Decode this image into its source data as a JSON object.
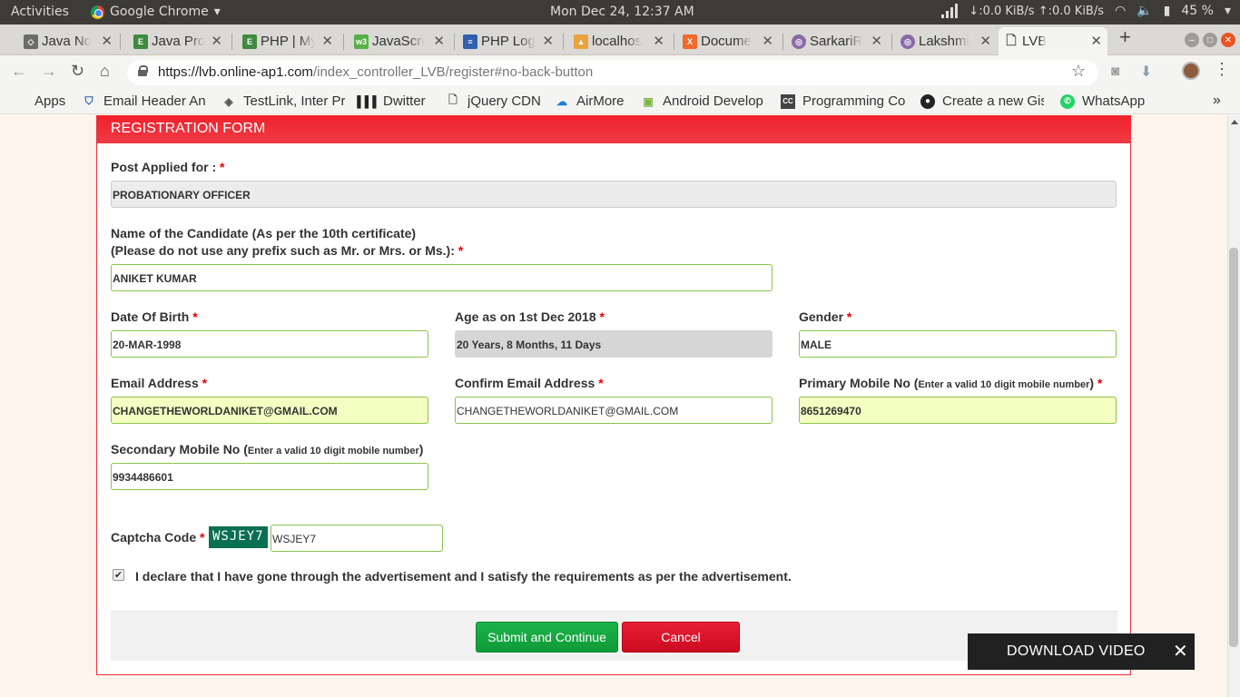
{
  "system_bar": {
    "activities": "Activities",
    "app_name": "Google Chrome",
    "clock": "Mon Dec 24, 12:37 AM",
    "net_speed": "↓:0.0 KiB/s ↑:0.0 KiB/s",
    "battery": "45 %"
  },
  "tabs": [
    {
      "label": "Java No",
      "icon": "java-notes-icon",
      "color": "#6b6b6b",
      "active": false
    },
    {
      "label": "Java Pro",
      "icon": "java-programs-icon",
      "color": "#3f8a3f",
      "active": false
    },
    {
      "label": "PHP | My",
      "icon": "php-icon",
      "color": "#3f8a3f",
      "active": false
    },
    {
      "label": "JavaScri",
      "icon": "javascript-icon",
      "color": "#57b047",
      "active": false
    },
    {
      "label": "PHP Log",
      "icon": "document-icon",
      "color": "#2f5fae",
      "active": false
    },
    {
      "label": "localhos",
      "icon": "xampp-icon",
      "color": "#e8a33d",
      "active": false
    },
    {
      "label": "Docume",
      "icon": "xampp-doc-icon",
      "color": "#f06a2a",
      "active": false
    },
    {
      "label": "SarkariR",
      "icon": "sarkari-icon",
      "color": "#8a6aa8",
      "active": false
    },
    {
      "label": "Lakshmi",
      "icon": "lakshmi-icon",
      "color": "#8a6aa8",
      "active": false
    },
    {
      "label": "LVB",
      "icon": "page-icon",
      "color": "#555555",
      "active": true
    }
  ],
  "address": {
    "url_host": "https://lvb.online-ap1.com",
    "url_path": "/index_controller_LVB/register#no-back-button"
  },
  "bookmarks": [
    {
      "label": "Apps"
    },
    {
      "label": "Email Header An"
    },
    {
      "label": "TestLink, Inter Pr"
    },
    {
      "label": "Dwitter"
    },
    {
      "label": "jQuery CDN"
    },
    {
      "label": "AirMore"
    },
    {
      "label": "Android Develop"
    },
    {
      "label": "Programming Co"
    },
    {
      "label": "Create a new Gis"
    },
    {
      "label": "WhatsApp"
    }
  ],
  "form": {
    "header": "REGISTRATION FORM",
    "post_label": "Post Applied for :",
    "post_value": "PROBATIONARY OFFICER",
    "name_label_line1": "Name of the Candidate (As per the 10th certificate)",
    "name_label_line2": "(Please do not use any prefix such as Mr. or Mrs. or Ms.):",
    "name_value": "ANIKET KUMAR",
    "dob_label": "Date Of Birth",
    "dob_value": "20-MAR-1998",
    "age_label": "Age as on 1st Dec 2018",
    "age_value": "20 Years, 8 Months, 11 Days",
    "gender_label": "Gender",
    "gender_value": "MALE",
    "email_label": "Email Address",
    "email_value": "CHANGETHEWORLDANIKET@GMAIL.COM",
    "confirm_email_label": "Confirm Email Address",
    "confirm_email_value": "CHANGETHEWORLDANIKET@GMAIL.COM",
    "primary_mobile_label": "Primary Mobile No (",
    "primary_mobile_hint": "Enter a valid 10 digit mobile number",
    "primary_mobile_value": "8651269470",
    "secondary_mobile_label": "Secondary Mobile No (",
    "secondary_mobile_hint": "Enter a valid 10 digit mobile number",
    "secondary_mobile_value": "9934486601",
    "captcha_label": "Captcha Code",
    "captcha_image_text": "WSJEY7",
    "captcha_value": "WSJEY7",
    "declaration": "I declare that I have gone through the advertisement and I satisfy the requirements as per the advertisement.",
    "declaration_checked": true,
    "submit_label": "Submit and Continue",
    "cancel_label": "Cancel",
    "required_mark": "*",
    "close_paren": ")"
  },
  "overlay": {
    "download_label": "DOWNLOAD VIDEO"
  },
  "colors": {
    "header_red": "#f0212b",
    "submit_green": "#1cb34a",
    "cancel_red": "#e81e35",
    "input_border": "#8bc34a",
    "highlight_yellow": "#f4ffc2"
  }
}
